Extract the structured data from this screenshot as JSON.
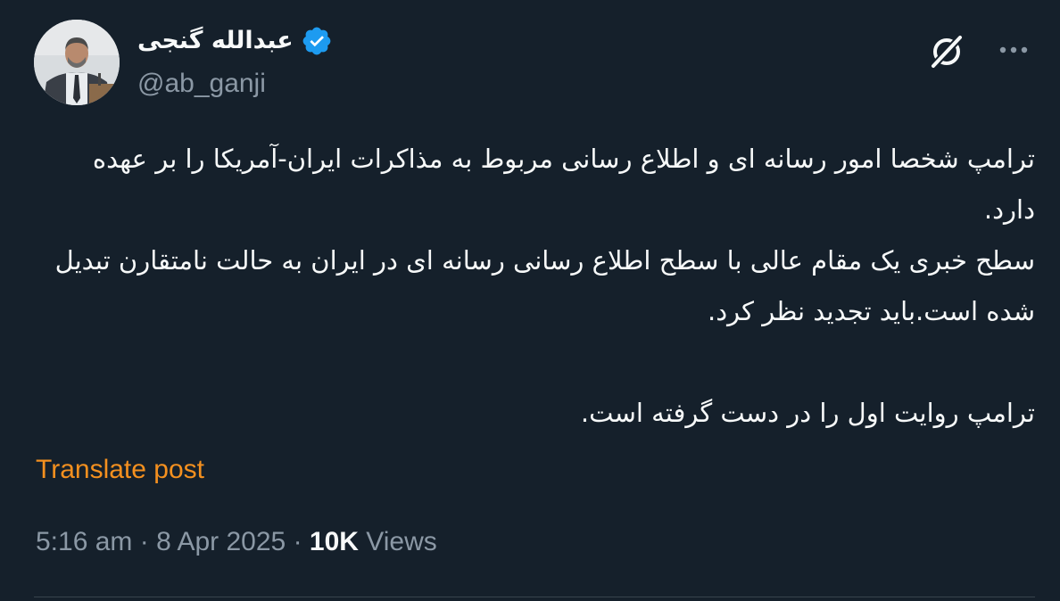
{
  "user": {
    "display_name": "عبدالله گنجی",
    "handle": "@ab_ganji",
    "verified": true,
    "verified_color": "#1d9bf0"
  },
  "header_icons": [
    "grok-icon",
    "more-icon"
  ],
  "tweet": {
    "paragraphs": [
      "ترامپ شخصا امور رسانه ای و اطلاع رسانی مربوط به مذاکرات ایران-آمریکا را بر عهده دارد.",
      "سطح خبری یک مقام عالی با سطح اطلاع رسانی رسانه ای در ایران به حالت نامتقارن تبدیل شده است.باید تجدید نظر کرد.",
      "",
      "ترامپ روایت اول را در دست گرفته است."
    ]
  },
  "translate_label": "Translate post",
  "meta": {
    "time": "5:16 am",
    "separator": "·",
    "date": "8 Apr 2025",
    "views_count": "10K",
    "views_label": "Views"
  },
  "colors": {
    "background": "#15202b",
    "text": "#f7f9f9",
    "secondary": "#8b98a5",
    "translate": "#f4901f"
  }
}
